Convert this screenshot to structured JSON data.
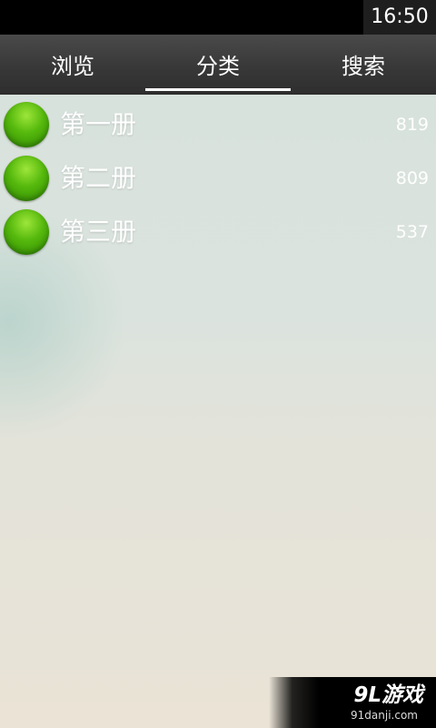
{
  "status_bar": {
    "time": "16:50"
  },
  "tabs": [
    {
      "label": "浏览",
      "active": false
    },
    {
      "label": "分类",
      "active": true
    },
    {
      "label": "搜索",
      "active": false
    }
  ],
  "categories": [
    {
      "label": "第一册",
      "count": "819",
      "icon": "green-circle-icon"
    },
    {
      "label": "第二册",
      "count": "809",
      "icon": "green-circle-icon"
    },
    {
      "label": "第三册",
      "count": "537",
      "icon": "green-circle-icon"
    }
  ],
  "watermark": {
    "main": "9L游戏",
    "sub": "91danji.com"
  },
  "colors": {
    "status_bar": "#000000",
    "tab_bar": "#383838",
    "active_indicator": "#ffffff",
    "dot_green": "#55b80c",
    "background_top": "#d8e2dc",
    "background_bottom": "#eae3d6"
  }
}
